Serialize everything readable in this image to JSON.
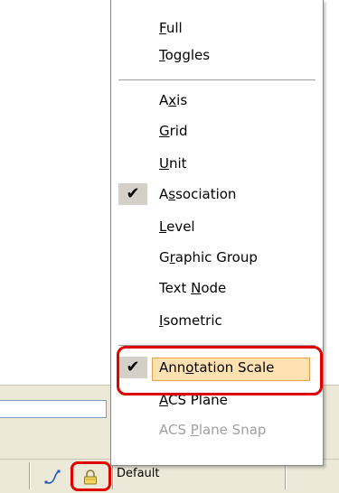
{
  "menu": {
    "items": [
      {
        "id": "full",
        "pre": "",
        "mn": "F",
        "post": "ull",
        "checked": false,
        "enabled": true
      },
      {
        "id": "toggles",
        "pre": "",
        "mn": "T",
        "post": "oggles",
        "checked": false,
        "enabled": true
      },
      {
        "id": "axis",
        "pre": "A",
        "mn": "x",
        "post": "is",
        "checked": false,
        "enabled": true
      },
      {
        "id": "grid",
        "pre": "",
        "mn": "G",
        "post": "rid",
        "checked": false,
        "enabled": true
      },
      {
        "id": "unit",
        "pre": "",
        "mn": "U",
        "post": "nit",
        "checked": false,
        "enabled": true
      },
      {
        "id": "association",
        "pre": "A",
        "mn": "s",
        "post": "sociation",
        "checked": true,
        "enabled": true
      },
      {
        "id": "level",
        "pre": "",
        "mn": "L",
        "post": "evel",
        "checked": false,
        "enabled": true
      },
      {
        "id": "graphic-group",
        "pre": "G",
        "mn": "r",
        "post": "aphic Group",
        "checked": false,
        "enabled": true
      },
      {
        "id": "text-node",
        "pre": "Text ",
        "mn": "N",
        "post": "ode",
        "checked": false,
        "enabled": true
      },
      {
        "id": "isometric",
        "pre": "",
        "mn": "I",
        "post": "sometric",
        "checked": false,
        "enabled": true
      },
      {
        "id": "annotation-scale",
        "pre": "Ann",
        "mn": "o",
        "post": "tation Scale",
        "checked": true,
        "enabled": true
      },
      {
        "id": "acs-plane",
        "pre": "",
        "mn": "A",
        "post": "CS Plane",
        "checked": false,
        "enabled": true
      },
      {
        "id": "acs-plane-snap",
        "pre": "ACS ",
        "mn": "P",
        "post": "lane Snap",
        "checked": false,
        "enabled": false
      }
    ],
    "check_glyph": "✔"
  },
  "status_bar": {
    "view_label": "Default",
    "icons": [
      "curve-icon",
      "lock-icon"
    ]
  },
  "colors": {
    "highlight_ring": "#e00000",
    "hover_fill": "#ffe2b0",
    "hover_border": "#e8a050",
    "disabled_text": "#a0a0a0"
  }
}
